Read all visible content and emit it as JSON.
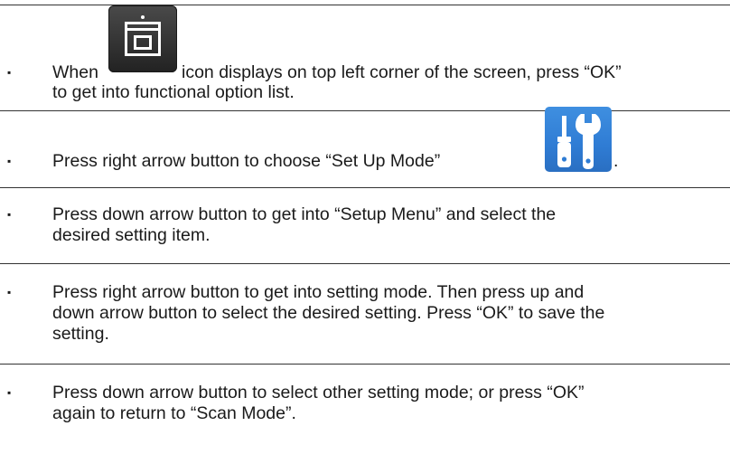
{
  "instructions": [
    {
      "bullet": "▪",
      "lines": [
        {
          "before_icon": "When",
          "after_icon": "icon displays on top left corner of the screen, press “OK”"
        },
        {
          "text": "to get into functional option list."
        }
      ],
      "icon": "scan-mode-icon"
    },
    {
      "bullet": "▪",
      "lines": [
        {
          "before_icon": "Press right arrow button to choose “Set Up Mode”",
          "after_icon": "."
        }
      ],
      "icon": "set-up-mode-icon"
    },
    {
      "bullet": "▪",
      "lines": [
        {
          "text": "Press down arrow button to get into “Setup Menu” and select the"
        },
        {
          "text": "desired setting item."
        }
      ]
    },
    {
      "bullet": "▪",
      "lines": [
        {
          "text": "Press right arrow button to get into setting mode. Then press up and"
        },
        {
          "text": "down arrow button to select the desired setting. Press “OK” to save the"
        },
        {
          "text": "setting."
        }
      ]
    },
    {
      "bullet": "▪",
      "lines": [
        {
          "text": "Press down arrow button to select other setting mode; or press “OK”"
        },
        {
          "text": "again to return to “Scan Mode”."
        }
      ]
    }
  ],
  "colors": {
    "text": "#1a1a1a",
    "rule": "#333333",
    "scan_icon_bg": "#343434",
    "setup_icon_bg": "#2f7cd4"
  }
}
